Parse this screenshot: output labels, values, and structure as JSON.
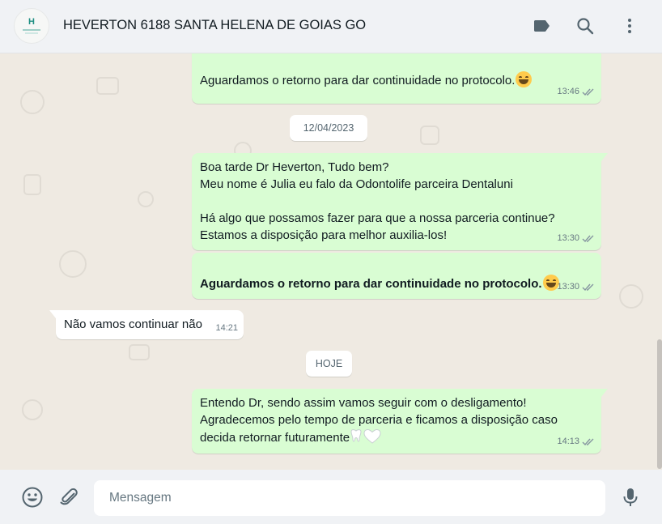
{
  "header": {
    "title": "HEVERTON 6188 SANTA HELENA DE GOIAS GO",
    "avatar_letter": "H"
  },
  "messages": [
    {
      "direction": "out",
      "text": "Aguardamos o retorno para dar continuidade no protocolo.",
      "emoji": "grinning-face-emoji",
      "time": "13:46",
      "status": "read"
    },
    {
      "type": "date",
      "label": "12/04/2023"
    },
    {
      "direction": "out",
      "text": "Boa tarde Dr Heverton, Tudo bem?\nMeu nome é Julia eu falo da Odontolife parceira Dentaluni\n\nHá algo que possamos fazer para que a nossa parceria continue?\nEstamos a disposição para melhor auxilia-los!",
      "time": "13:30",
      "status": "read"
    },
    {
      "direction": "out",
      "text": "Aguardamos o retorno para dar continuidade no protocolo.",
      "bold": true,
      "emoji": "grinning-face-emoji",
      "time": "13:30",
      "status": "read"
    },
    {
      "direction": "in",
      "text": "Não vamos continuar não",
      "time": "14:21"
    },
    {
      "type": "date",
      "label": "HOJE"
    },
    {
      "direction": "out",
      "text": "Entendo Dr, sendo assim vamos seguir com o desligamento!\nAgradecemos pelo tempo de parceria e ficamos a disposição caso\ndecida retornar futuramente",
      "emoji": "tooth-and-white-heart-emoji",
      "time": "14:13",
      "status": "read"
    }
  ],
  "composer": {
    "placeholder": "Mensagem"
  },
  "colors": {
    "outgoing_bubble": "#d9fdd3",
    "incoming_bubble": "#ffffff",
    "chat_background": "#efeae2",
    "header_background": "#f0f2f5",
    "read_ticks": "#8696a0"
  }
}
